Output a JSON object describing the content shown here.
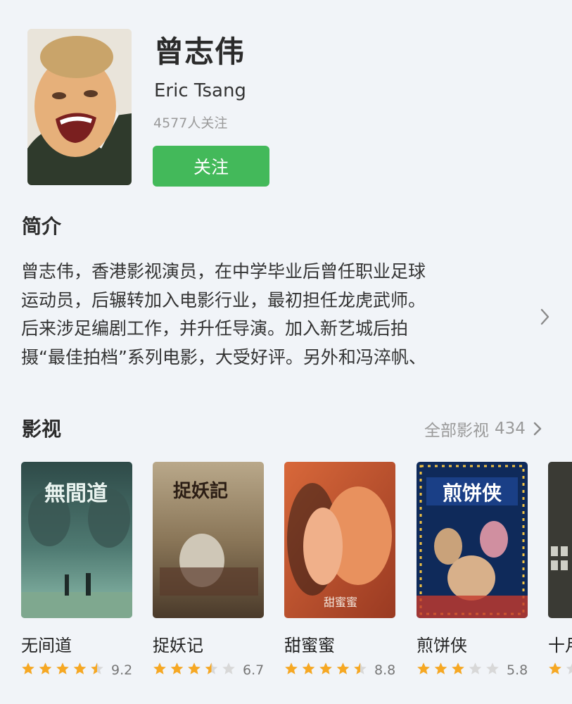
{
  "person": {
    "name_cn": "曾志伟",
    "name_en": "Eric Tsang",
    "followers": "4577人关注",
    "follow_label": "关注"
  },
  "intro": {
    "title": "简介",
    "lines": [
      "曾志伟，香港影视演员，在中学毕业后曾任职业足球",
      "运动员，后辗转加入电影行业，最初担任龙虎武师。",
      "后来涉足编剧工作，并升任导演。加入新艺城后拍",
      "摄“最佳拍档”系列电影，大受好评。另外和冯淬帆、"
    ]
  },
  "works": {
    "title": "影视",
    "all_label": "全部影视",
    "all_count": "434",
    "movies": [
      {
        "title": "无间道",
        "score": "9.2",
        "stars": 4.5,
        "poster_text": "無間道"
      },
      {
        "title": "捉妖记",
        "score": "6.7",
        "stars": 3.5,
        "poster_text": "捉妖記"
      },
      {
        "title": "甜蜜蜜",
        "score": "8.8",
        "stars": 4.5,
        "poster_text": "甜蜜蜜"
      },
      {
        "title": "煎饼侠",
        "score": "5.8",
        "stars": 3,
        "poster_text": "煎饼侠"
      },
      {
        "title": "十月",
        "score": "",
        "stars": 1,
        "poster_text": ""
      }
    ]
  },
  "colors": {
    "accent_green": "#43b95a",
    "star_filled": "#f6a823",
    "star_empty": "#d8d8d8",
    "background": "#f1f4f8"
  }
}
